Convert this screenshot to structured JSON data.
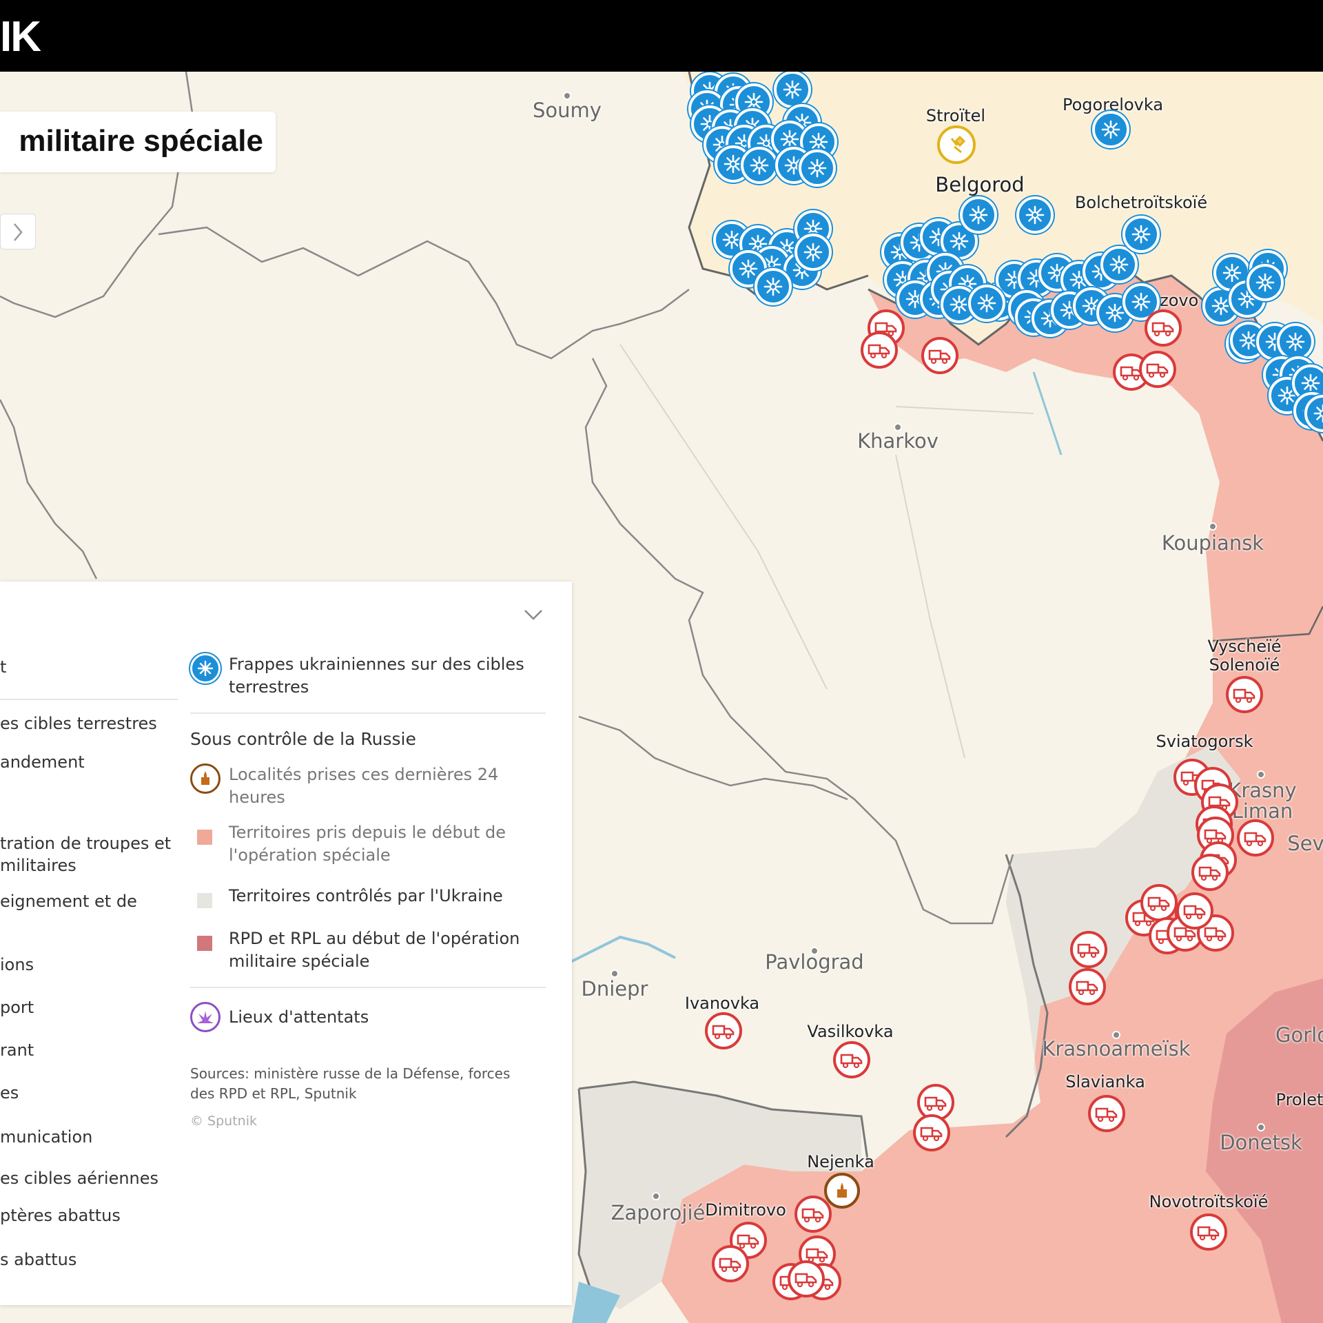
{
  "header": {
    "logo_text": "IK"
  },
  "title": {
    "text": "militaire spéciale"
  },
  "cities": [
    {
      "name": "Soumy"
    },
    {
      "name": "Kharkov"
    },
    {
      "name": "Koupiansk"
    },
    {
      "name": "Pavlograd"
    },
    {
      "name": "Dniepr"
    },
    {
      "name": "Krasnoarmeïsk"
    },
    {
      "name": "Donetsk"
    },
    {
      "name": "Zaporojié"
    },
    {
      "name": "Krasny\nLiman"
    },
    {
      "name": "Sev"
    },
    {
      "name": "Gorlo"
    }
  ],
  "places": [
    {
      "name": "Stroïtel"
    },
    {
      "name": "Pogorelovka"
    },
    {
      "name": "Belgorod"
    },
    {
      "name": "Bolchetroïtskoïé"
    },
    {
      "name": "Bouzovo"
    },
    {
      "name": "Vyscheïé\nSolenoïé"
    },
    {
      "name": "Sviatogorsk"
    },
    {
      "name": "Ivanovka"
    },
    {
      "name": "Vasilkovka"
    },
    {
      "name": "Slavianka"
    },
    {
      "name": "Nejenka"
    },
    {
      "name": "Dimitrovo"
    },
    {
      "name": "Novotroïtskoïé"
    },
    {
      "name": "Prolet"
    }
  ],
  "legend": {
    "left_column": [
      "t",
      "es cibles terrestres",
      "andement",
      "tration de troupes et",
      "militaires",
      "eignement et de",
      "ions",
      "port",
      "rant",
      "es",
      "munication",
      "es cibles aériennes",
      "ptères abattus",
      "s abattus"
    ],
    "items": [
      {
        "label": "Frappes ukrainiennes sur des cibles terrestres",
        "icon": "ukraine-strike-icon"
      },
      {
        "label": "Localités prises ces dernières 24 heures",
        "icon": "captured-locality-icon"
      },
      {
        "label": "Territoires pris depuis le début de l'opération spéciale",
        "icon": "square-swatch",
        "color": "#f0a898"
      },
      {
        "label": "Territoires contrôlés par l'Ukraine",
        "icon": "square-swatch",
        "color": "#e6e6e1"
      },
      {
        "label": "RPD et RPL au début de l'opération militaire spéciale",
        "icon": "square-swatch",
        "color": "#d1787c"
      },
      {
        "label": "Lieux d'attentats",
        "icon": "attack-site-icon"
      }
    ],
    "heading_russia": "Sous contrôle de la Russie",
    "sources": "Sources: ministère russe de la Défense, forces des RPD et RPL, Sputnik",
    "copyright": "© Sputnik"
  },
  "colors": {
    "russia_bg": "#fbf0d6",
    "russia_taken": "#f5b8ab",
    "ukraine_controlled": "#e6e3dc",
    "dpr_lpr_start": "#e69a97",
    "strike_blue": "#1c8fd8",
    "russian_strike_red": "#d93a3a"
  }
}
